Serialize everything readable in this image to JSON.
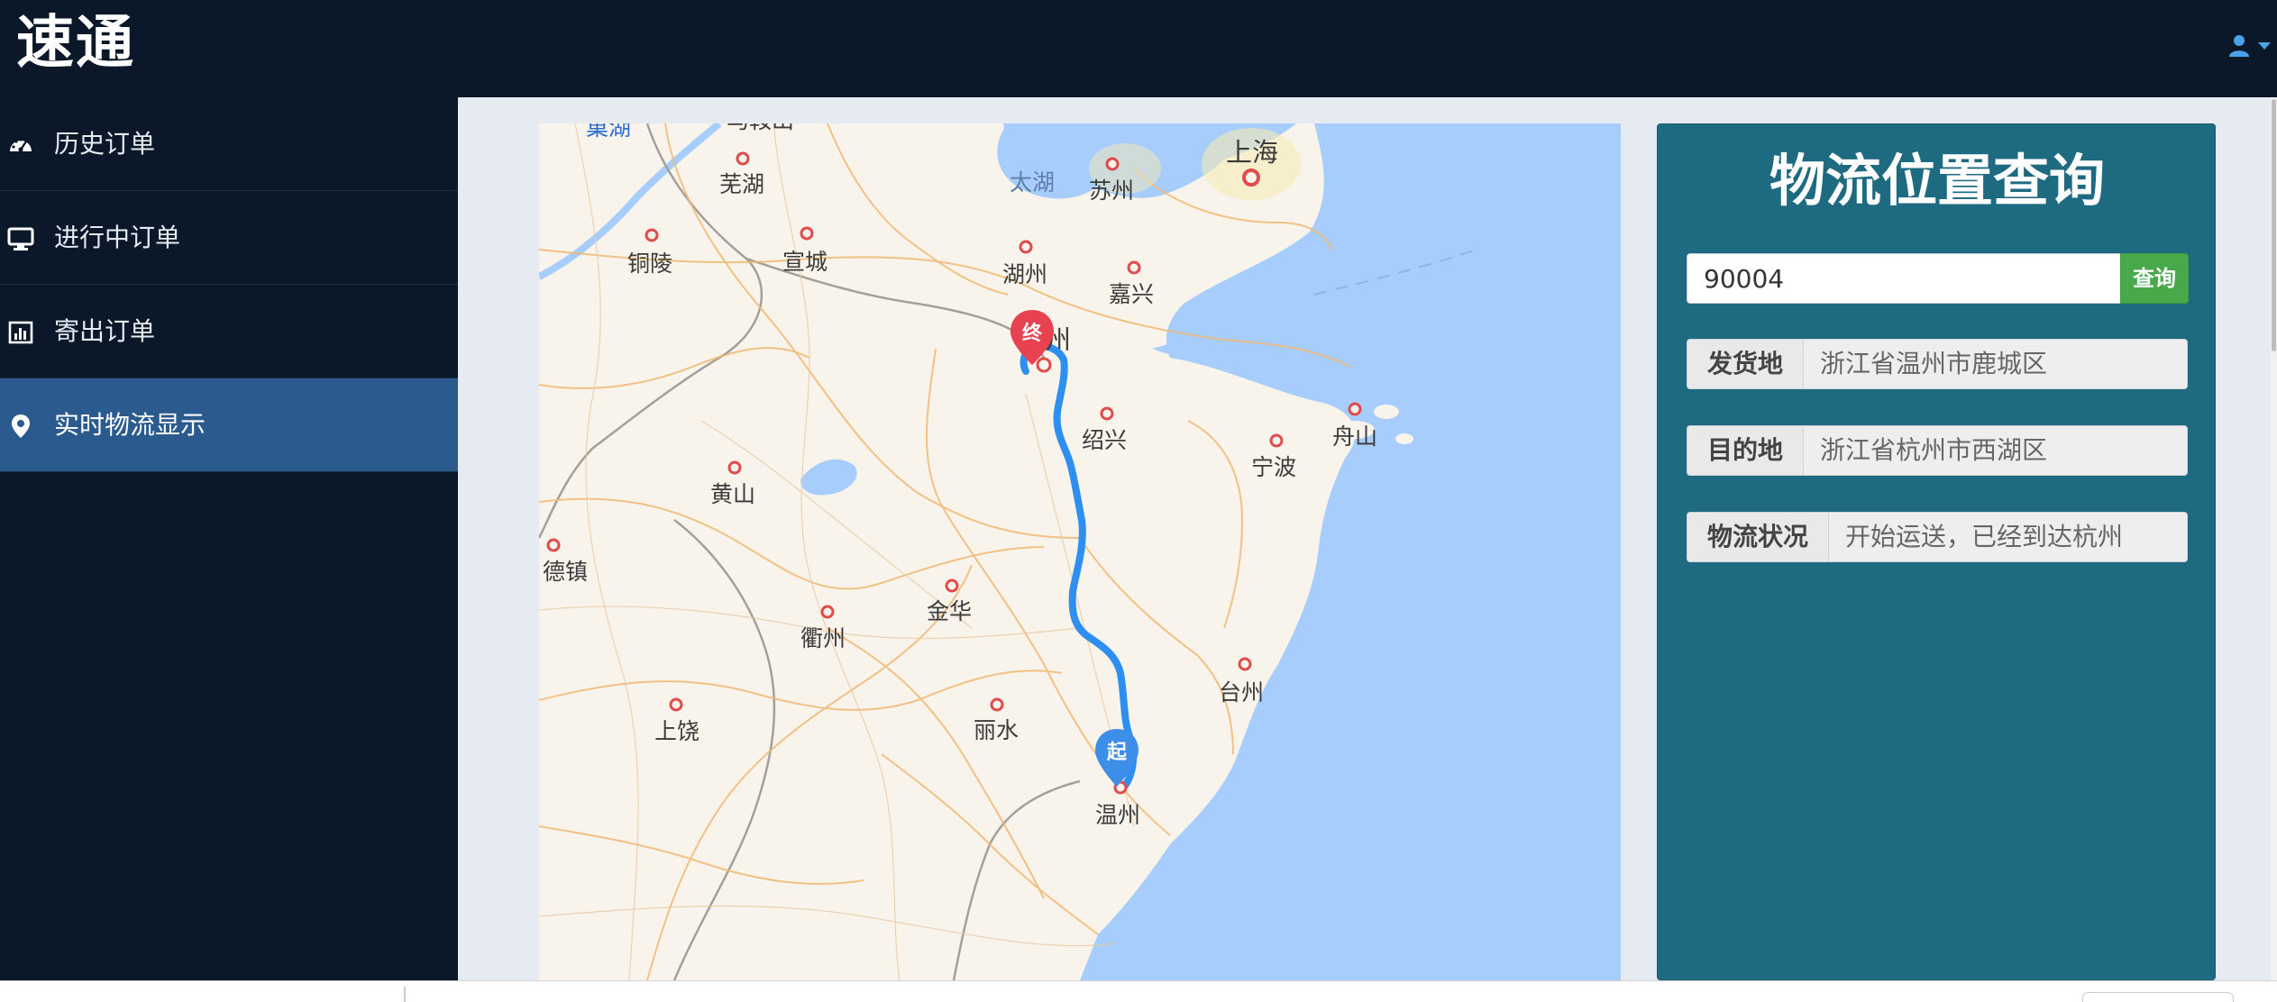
{
  "app": {
    "brand": "速通"
  },
  "header": {
    "user_icon": "user-icon",
    "caret_icon": "caret-down-icon",
    "accent": "#4aa3e8"
  },
  "sidebar": {
    "items": [
      {
        "label": "历史订单",
        "icon": "dashboard-icon"
      },
      {
        "label": "进行中订单",
        "icon": "monitor-icon"
      },
      {
        "label": "寄出订单",
        "icon": "bar-chart-icon"
      },
      {
        "label": "实时物流显示",
        "icon": "map-marker-icon",
        "active": true
      }
    ],
    "active_color": "#2b5a8f"
  },
  "panel": {
    "title": "物流位置查询",
    "search": {
      "value": "90004",
      "button": "查询"
    },
    "rows": [
      {
        "label": "发货地",
        "value": "浙江省温州市鹿城区"
      },
      {
        "label": "目的地",
        "value": "浙江省杭州市西湖区"
      },
      {
        "label": "物流状况",
        "value": "开始运送，已经到达杭州"
      }
    ],
    "background": "#1e6a80",
    "button_color": "#48a94b"
  },
  "map": {
    "cities": {
      "chaohu": "巢湖",
      "maanshan": "马鞍山",
      "wuhu": "芜湖",
      "tongling": "铜陵",
      "xuancheng": "宣城",
      "taihu": "太湖",
      "suzhou": "苏州",
      "shanghai": "上海",
      "huzhou": "湖州",
      "jiaxing": "嘉兴",
      "hangzhou": "杭州",
      "shaoxing": "绍兴",
      "ningbo": "宁波",
      "zhoushan": "舟山",
      "huangshan": "黄山",
      "dezhen": "德镇",
      "quzhou": "衢州",
      "jinhua": "金华",
      "taizhou": "台州",
      "shangrao": "上饶",
      "lishui": "丽水",
      "wenzhou": "温州"
    },
    "markers": {
      "end": "终",
      "start": "起"
    },
    "route_color": "#2e8ff0",
    "sea_color": "#a6cdfb",
    "land_color": "#f8f4ec"
  }
}
